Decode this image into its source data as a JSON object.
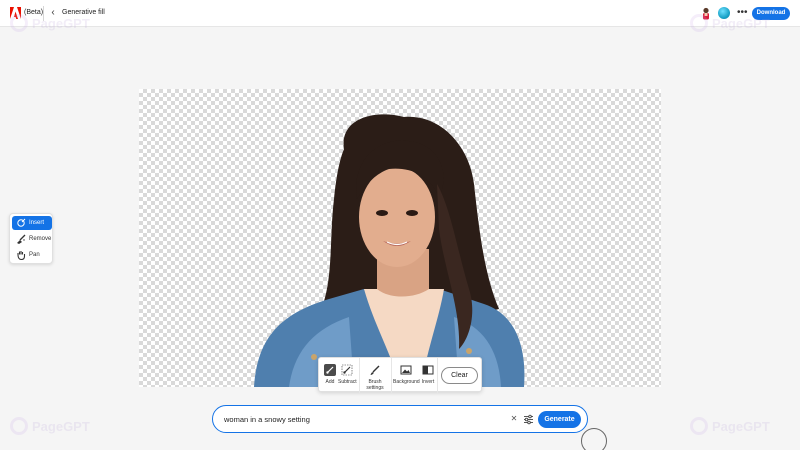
{
  "header": {
    "beta_label": "(Beta)",
    "back_icon": "chevron-left-icon",
    "title": "Generative fill",
    "more_icon": "more-horizontal-icon",
    "download_label": "Download"
  },
  "tools": [
    {
      "label": "Insert",
      "icon": "insert-brush-icon",
      "active": true
    },
    {
      "label": "Remove",
      "icon": "remove-brush-icon",
      "active": false
    },
    {
      "label": "Pan",
      "icon": "hand-icon",
      "active": false
    }
  ],
  "brushbar": {
    "add_label": "Add",
    "subtract_label": "Subtract",
    "brush_settings_label": "Brush settings",
    "background_label": "Background",
    "invert_label": "Invert",
    "clear_label": "Clear"
  },
  "prompt": {
    "value": "woman in a snowy setting",
    "clear_icon": "close-icon",
    "settings_icon": "sliders-icon",
    "generate_label": "Generate"
  },
  "watermark": {
    "text": "PageGPT"
  },
  "colors": {
    "accent": "#1473e6",
    "canvas_checker": "#d9d9d9",
    "background": "#f5f5f5"
  }
}
